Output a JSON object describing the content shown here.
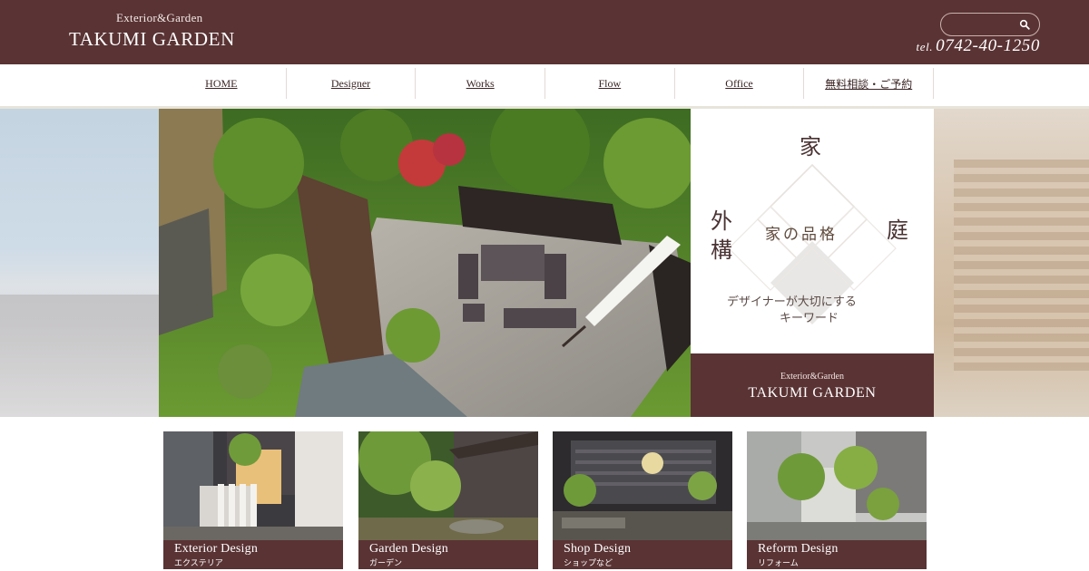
{
  "header": {
    "logo_sub": "Exterior&Garden",
    "logo_main": "TAKUMI GARDEN",
    "search": {
      "value": "",
      "placeholder": "",
      "icon": "search-icon"
    },
    "tel_prefix": "tel.",
    "tel_number": "0742-40-1250"
  },
  "nav": {
    "items": [
      {
        "label": "HOME"
      },
      {
        "label": "Designer"
      },
      {
        "label": "Works"
      },
      {
        "label": "Flow"
      },
      {
        "label": "Office"
      },
      {
        "label": "無料相談・ご予約"
      }
    ]
  },
  "hero": {
    "char_ie": "家",
    "gaikou_1": "外",
    "gaikou_2": "構",
    "char_niwa": "庭",
    "center": "家の品格",
    "tagline_1": "デザイナーが大切にする",
    "tagline_2": "キーワード",
    "footer_sub": "Exterior&Garden",
    "footer_main": "TAKUMI GARDEN"
  },
  "cards": [
    {
      "en": "Exterior Design",
      "jp": "エクステリア"
    },
    {
      "en": "Garden Design",
      "jp": "ガーデン"
    },
    {
      "en": "Shop Design",
      "jp": "ショップなど"
    },
    {
      "en": "Reform Design",
      "jp": "リフォーム"
    }
  ],
  "colors": {
    "brand": "#5a3334",
    "nav_text": "#3b2424",
    "foliage": "#6f9a3a",
    "maple": "#c43a3a"
  }
}
